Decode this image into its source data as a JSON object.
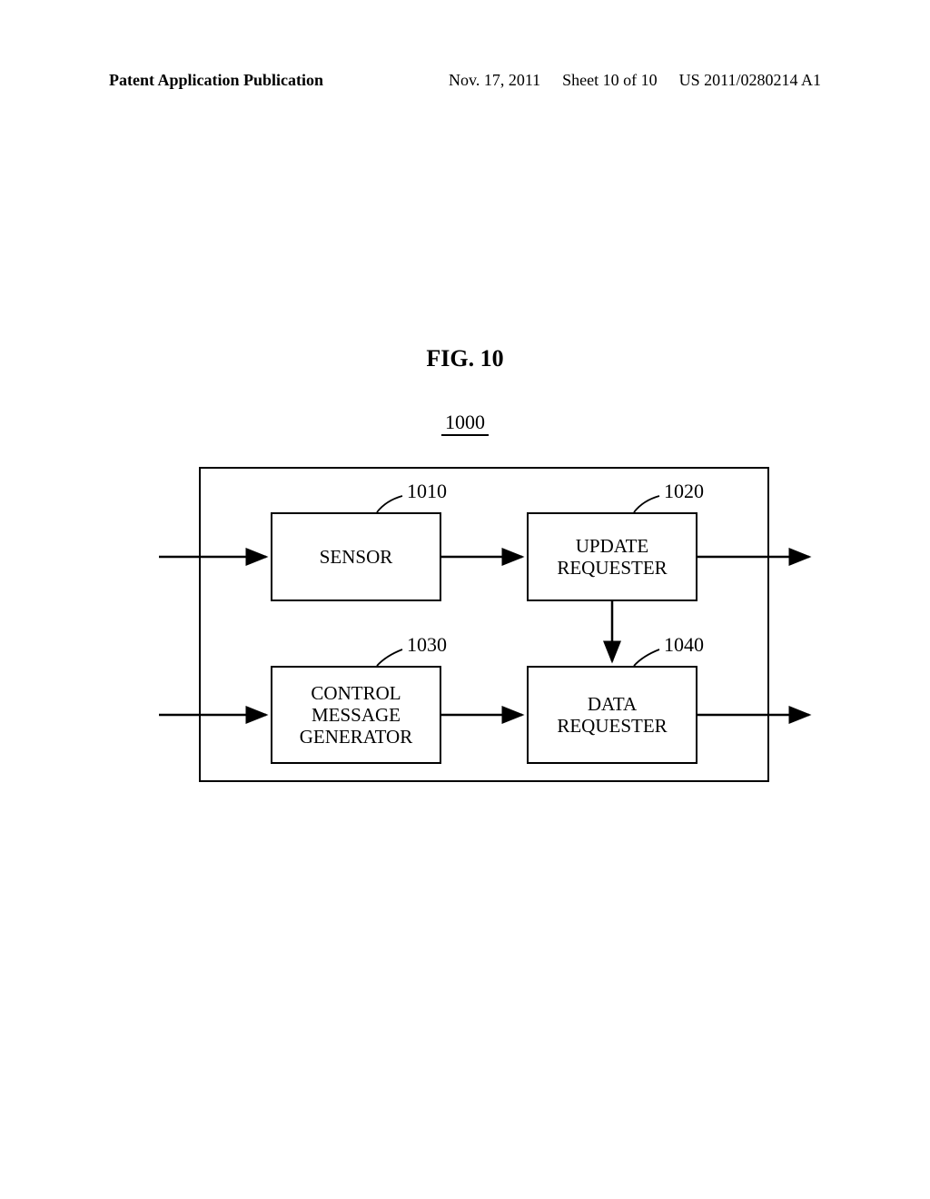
{
  "header": {
    "left": "Patent Application Publication",
    "date": "Nov. 17, 2011",
    "sheet": "Sheet 10 of 10",
    "pubno": "US 2011/0280214 A1"
  },
  "figure": {
    "title": "FIG. 10",
    "main_ref": "1000",
    "blocks": {
      "sensor": {
        "label": "SENSOR",
        "ref": "1010"
      },
      "update": {
        "label": "UPDATE\nREQUESTER",
        "ref": "1020"
      },
      "control": {
        "label": "CONTROL\nMESSAGE\nGENERATOR",
        "ref": "1030"
      },
      "data": {
        "label": "DATA\nREQUESTER",
        "ref": "1040"
      }
    }
  }
}
